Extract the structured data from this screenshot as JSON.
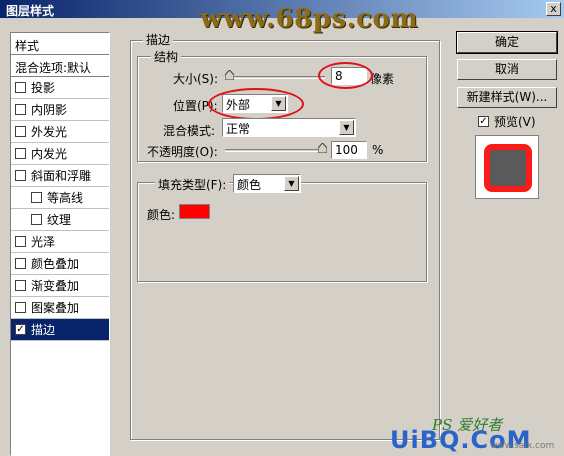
{
  "window": {
    "title": "图层样式",
    "close": "x"
  },
  "watermark": {
    "top": "www.68ps.com",
    "ps": "PS 爱好者",
    "uibq": "UiBQ.CoM",
    "small": "www.saix.com"
  },
  "sidebar": {
    "header": "样式",
    "blend": "混合选项:默认",
    "items": [
      {
        "label": "投影",
        "checked": false
      },
      {
        "label": "内阴影",
        "checked": false
      },
      {
        "label": "外发光",
        "checked": false
      },
      {
        "label": "内发光",
        "checked": false
      },
      {
        "label": "斜面和浮雕",
        "checked": false
      },
      {
        "label": "等高线",
        "checked": false
      },
      {
        "label": "纹理",
        "checked": false
      },
      {
        "label": "光泽",
        "checked": false
      },
      {
        "label": "颜色叠加",
        "checked": false
      },
      {
        "label": "渐变叠加",
        "checked": false
      },
      {
        "label": "图案叠加",
        "checked": false
      },
      {
        "label": "描边",
        "checked": true
      }
    ],
    "check_mark": "✓"
  },
  "stroke": {
    "group_title": "描边",
    "structure_title": "结构",
    "size_label": "大小(S):",
    "size_value": "8",
    "size_unit": "像素",
    "position_label": "位置(P):",
    "position_value": "外部",
    "blend_label": "混合模式:",
    "blend_value": "正常",
    "opacity_label": "不透明度(O):",
    "opacity_value": "100",
    "opacity_unit": "%",
    "fill_type_label": "填充类型(F):",
    "fill_type_value": "颜色",
    "color_label": "颜色:",
    "stroke_color": "#ff0000"
  },
  "buttons": {
    "ok": "确定",
    "cancel": "取消",
    "new_style": "新建样式(W)...",
    "preview_label": "预览(V)",
    "preview_checked": "✓"
  },
  "arrow_glyph": "▼",
  "colors": {
    "accent_red": "#e0101c",
    "selected_bg": "#0a246a"
  }
}
